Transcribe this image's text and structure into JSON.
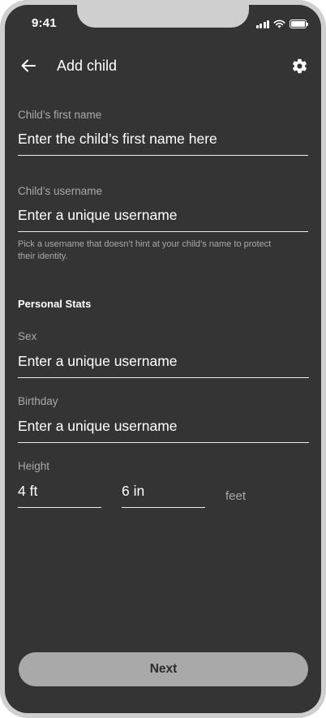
{
  "status_bar": {
    "time": "9:41"
  },
  "header": {
    "title": "Add child",
    "back_icon": "arrow-left-icon",
    "settings_icon": "gear-icon"
  },
  "form": {
    "first_name": {
      "label": "Child’s first name",
      "placeholder": "Enter the child’s first name here",
      "value": ""
    },
    "username": {
      "label": "Child’s username",
      "placeholder": "Enter a unique username",
      "value": "",
      "helper": "Pick a username that doesn’t hint at your child’s name to protect their identity."
    },
    "section_heading": "Personal Stats",
    "sex": {
      "label": "Sex",
      "placeholder": "Enter a unique username",
      "value": ""
    },
    "birthday": {
      "label": "Birthday",
      "placeholder": "Enter a unique username",
      "value": ""
    },
    "height": {
      "label": "Height",
      "feet_value": "4 ft",
      "inches_value": "6 in",
      "unit": "feet"
    }
  },
  "footer": {
    "next_label": "Next"
  },
  "colors": {
    "background": "#343434",
    "frame": "#cfcfcf",
    "label": "#a9a9a9",
    "text": "#ffffff",
    "button": "#a9a9a9"
  }
}
